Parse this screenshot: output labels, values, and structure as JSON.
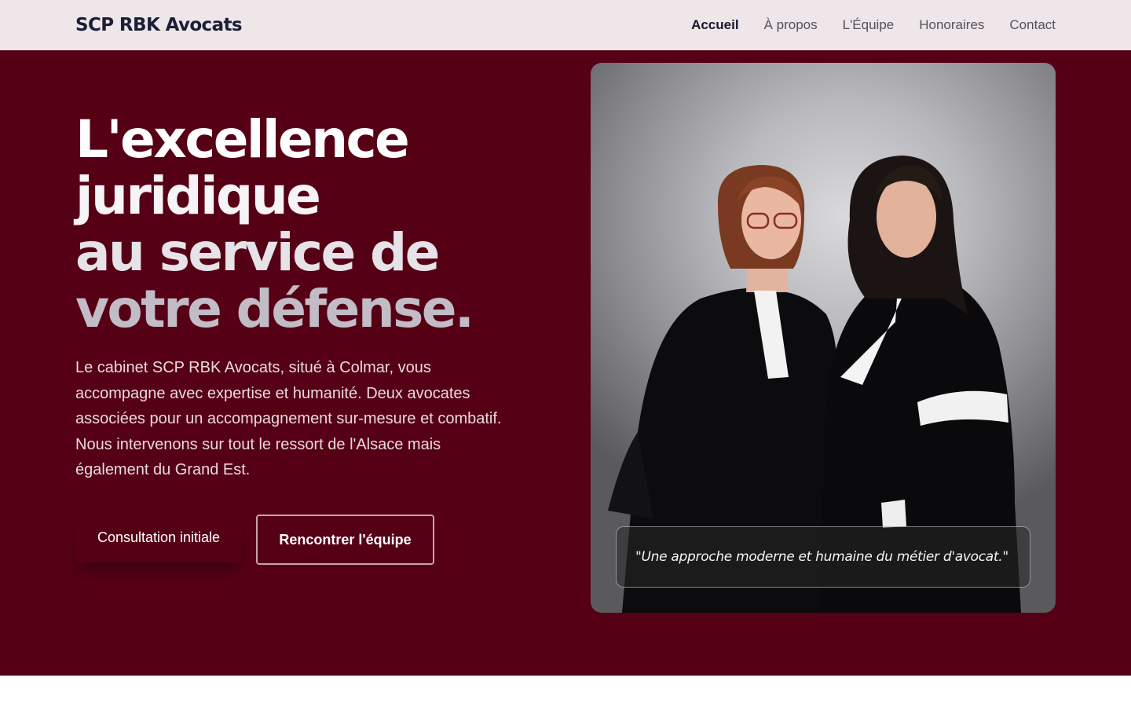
{
  "header": {
    "brand": "SCP RBK Avocats",
    "nav": [
      "Accueil",
      "À propos",
      "L'Équipe",
      "Honoraires",
      "Contact"
    ],
    "active_nav": "Accueil"
  },
  "hero": {
    "headline_lines": [
      "L'excellence",
      "juridique",
      "au service de",
      "votre défense."
    ],
    "lead": "Le cabinet SCP RBK Avocats, situé à Colmar, vous accompagne avec expertise et humanité. Deux avocates associées pour un accompagnement sur-mesure et combatif. Nous intervenons sur tout le ressort de l'Alsace mais également du Grand Est.",
    "primary_cta": "Consultation initiale",
    "secondary_cta": "Rencontrer l'équipe",
    "quote": "\"Une approche moderne et humaine du métier d'avocat.\""
  },
  "colors": {
    "hero_background": "#560016",
    "header_background": "#eee6e9",
    "brand_text": "#1a1f36"
  }
}
